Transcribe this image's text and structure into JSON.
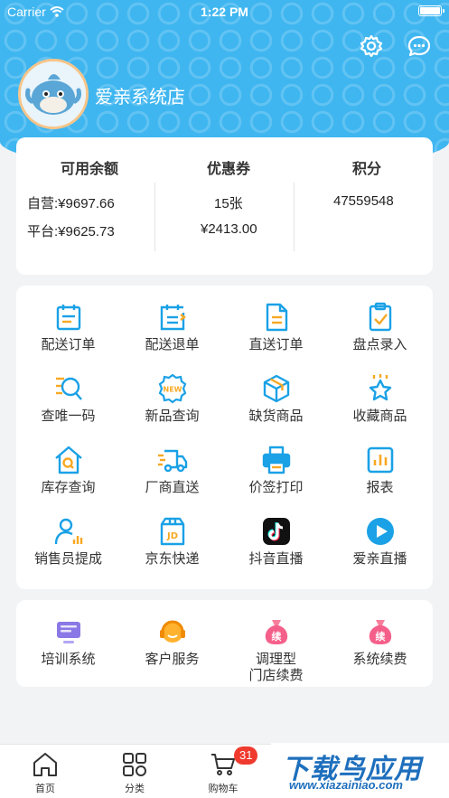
{
  "status_bar": {
    "carrier": "Carrier",
    "time": "1:22 PM"
  },
  "store": {
    "name": "爱亲系统店"
  },
  "balance": {
    "available": {
      "title": "可用余额",
      "self_run": "自营:¥9697.66",
      "platform": "平台:¥9625.73"
    },
    "coupons": {
      "title": "优惠券",
      "count": "15张",
      "amount": "¥2413.00"
    },
    "points": {
      "title": "积分",
      "value": "47559548"
    }
  },
  "menu": [
    {
      "label": "配送订单",
      "icon": "calendar-icon"
    },
    {
      "label": "配送退单",
      "icon": "return-calendar-icon"
    },
    {
      "label": "直送订单",
      "icon": "document-icon"
    },
    {
      "label": "盘点录入",
      "icon": "clipboard-check-icon"
    },
    {
      "label": "查唯一码",
      "icon": "search-code-icon"
    },
    {
      "label": "新品查询",
      "icon": "new-badge-icon"
    },
    {
      "label": "缺货商品",
      "icon": "box-icon"
    },
    {
      "label": "收藏商品",
      "icon": "star-icon"
    },
    {
      "label": "库存查询",
      "icon": "house-search-icon"
    },
    {
      "label": "厂商直送",
      "icon": "truck-icon"
    },
    {
      "label": "价签打印",
      "icon": "printer-icon"
    },
    {
      "label": "报表",
      "icon": "bar-chart-icon"
    },
    {
      "label": "销售员提成",
      "icon": "salesperson-icon"
    },
    {
      "label": "京东快递",
      "icon": "jd-package-icon"
    },
    {
      "label": "抖音直播",
      "icon": "tiktok-icon"
    },
    {
      "label": "爱亲直播",
      "icon": "play-icon"
    }
  ],
  "services": [
    {
      "label": "培训系统",
      "icon": "training-screen-icon"
    },
    {
      "label": "客户服务",
      "icon": "headset-icon"
    },
    {
      "label": "调理型\n门店续费",
      "icon": "renew-bag-icon",
      "glyph": "续"
    },
    {
      "label": "系统续费",
      "icon": "renew-bag-icon",
      "glyph": "续"
    }
  ],
  "tabs": [
    {
      "label": "首页",
      "icon": "home-icon"
    },
    {
      "label": "分类",
      "icon": "grid-icon"
    },
    {
      "label": "购物车",
      "icon": "cart-icon"
    }
  ],
  "cart_badge": "31",
  "watermark": {
    "brand": "下载鸟应用",
    "url": "www.xiazainiao.com"
  },
  "colors": {
    "primary": "#3fb6f0",
    "icon_blue": "#1aa1e6",
    "accent_orange": "#f7a823",
    "badge_red": "#f03a2e"
  }
}
